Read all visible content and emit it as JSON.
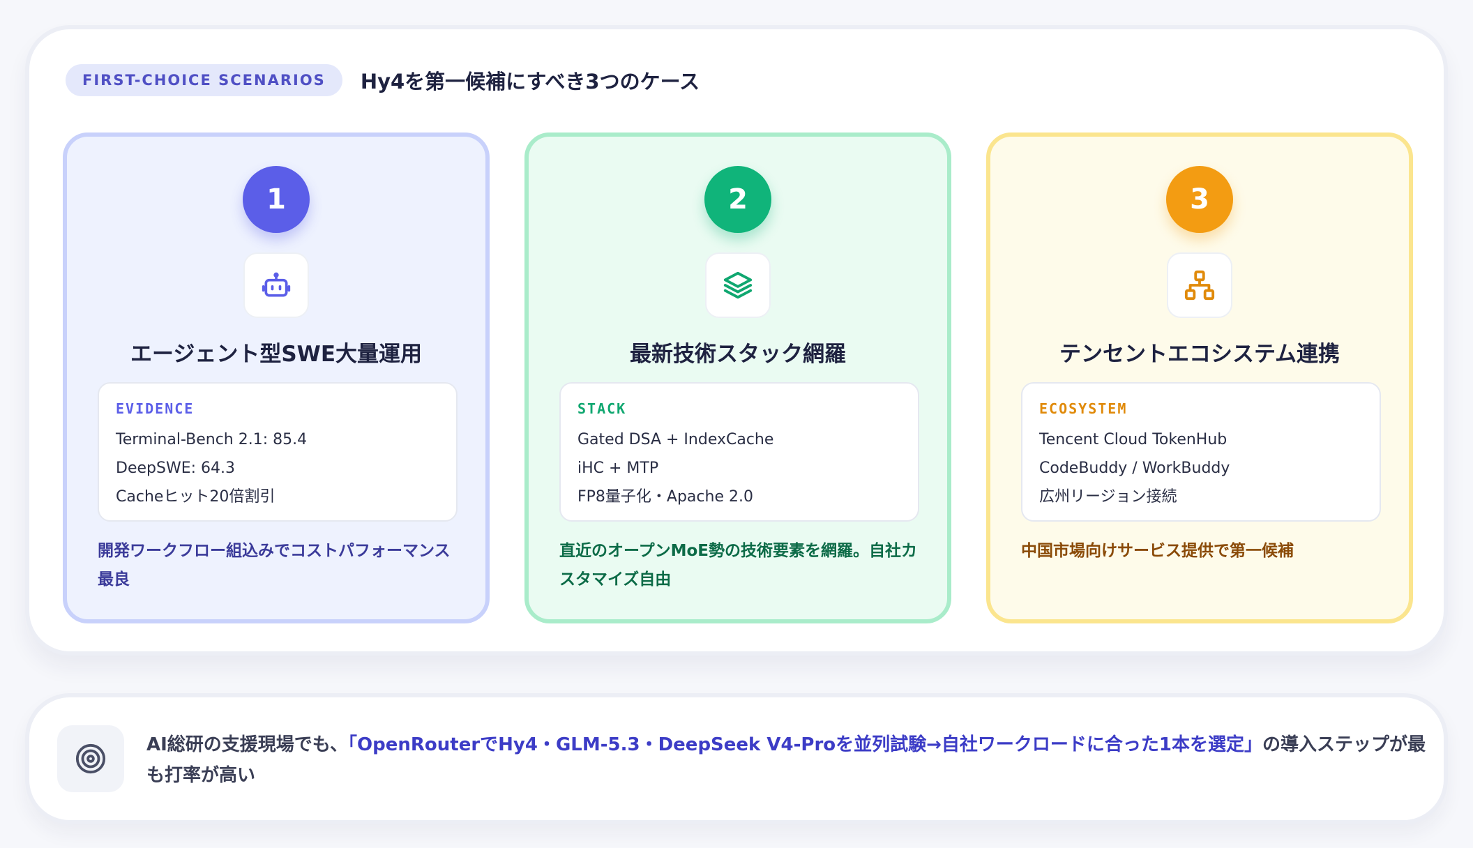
{
  "header": {
    "badge": "FIRST-CHOICE SCENARIOS",
    "title": "Hy4を第一候補にすべき3つのケース"
  },
  "colors": {
    "indigo": "#5b5ee8",
    "green": "#10b47a",
    "amber": "#f39c12"
  },
  "cards": [
    {
      "number": "1",
      "icon": "robot-icon",
      "title": "エージェント型SWE大量運用",
      "label": "EVIDENCE",
      "items": [
        "Terminal-Bench 2.1: 85.4",
        "DeepSWE: 64.3",
        "Cacheヒット20倍割引"
      ],
      "summary": "開発ワークフロー組込みでコストパフォーマンス最良"
    },
    {
      "number": "2",
      "icon": "layers-icon",
      "title": "最新技術スタック網羅",
      "label": "STACK",
      "items": [
        "Gated DSA + IndexCache",
        "iHC + MTP",
        "FP8量子化・Apache 2.0"
      ],
      "summary": "直近のオープンMoE勢の技術要素を網羅。自社カスタマイズ自由"
    },
    {
      "number": "3",
      "icon": "network-icon",
      "title": "テンセントエコシステム連携",
      "label": "ECOSYSTEM",
      "items": [
        "Tencent Cloud TokenHub",
        "CodeBuddy / WorkBuddy",
        "広州リージョン接続"
      ],
      "summary": "中国市場向けサービス提供で第一候補"
    }
  ],
  "bottom": {
    "icon": "target-icon",
    "prefix": "AI総研の支援現場でも、",
    "highlight": "「OpenRouterでHy4・GLM-5.3・DeepSeek V4-Proを並列試験→自社ワークロードに合った1本を選定」",
    "suffix": "の導入ステップが最も打率が高い"
  }
}
